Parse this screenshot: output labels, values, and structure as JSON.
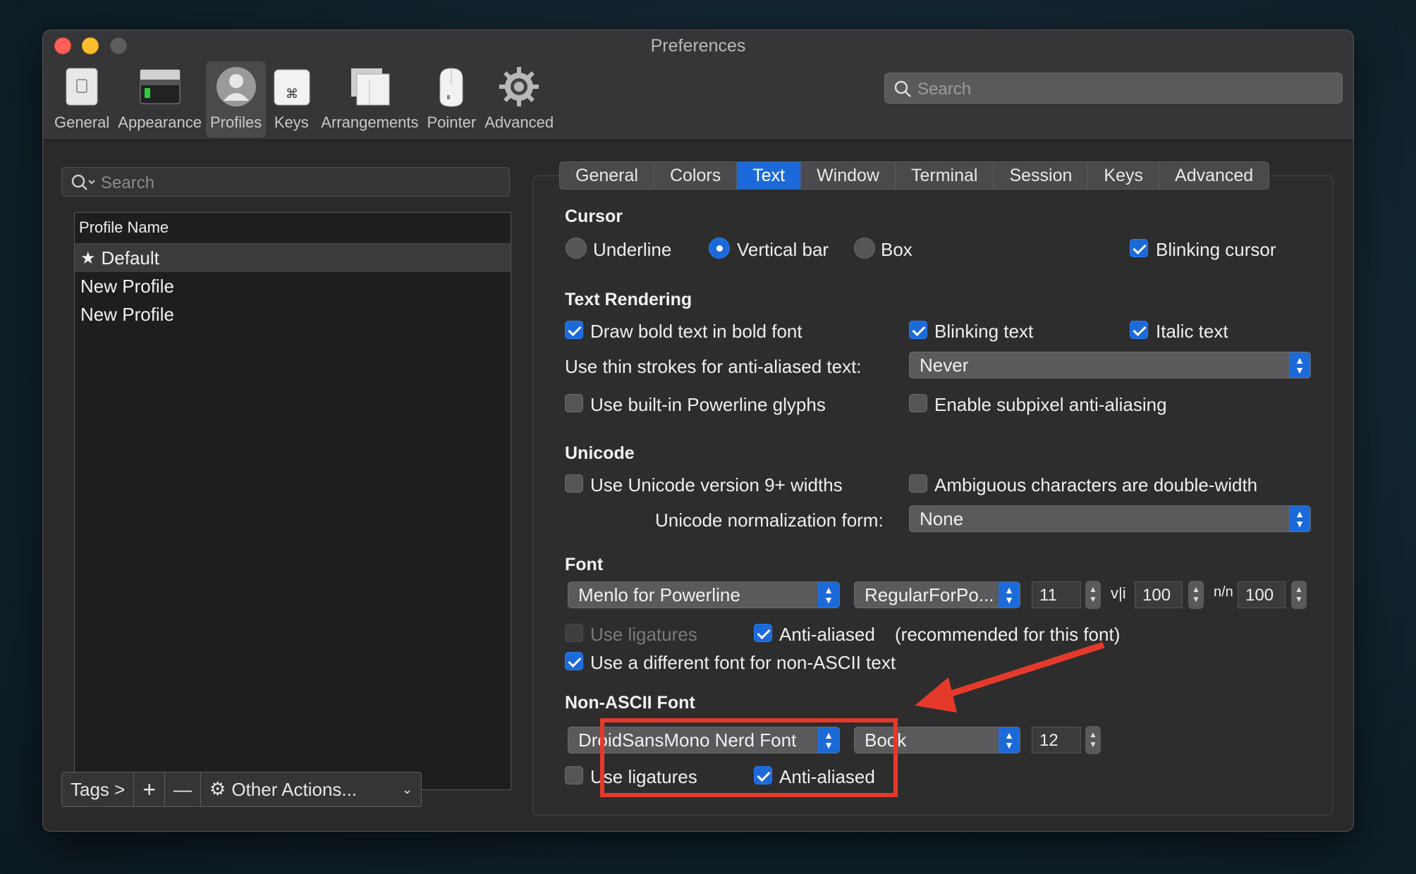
{
  "window": {
    "title": "Preferences"
  },
  "toolbar": {
    "items": [
      {
        "label": "General",
        "icon": "general-icon"
      },
      {
        "label": "Appearance",
        "icon": "appearance-icon"
      },
      {
        "label": "Profiles",
        "icon": "profiles-icon",
        "active": true
      },
      {
        "label": "Keys",
        "icon": "keys-icon"
      },
      {
        "label": "Arrangements",
        "icon": "arrangements-icon"
      },
      {
        "label": "Pointer",
        "icon": "pointer-icon"
      },
      {
        "label": "Advanced",
        "icon": "gear-icon"
      }
    ],
    "search_placeholder": "Search"
  },
  "profiles": {
    "search_placeholder": "Search",
    "header": "Profile Name",
    "items": [
      {
        "name": "Default",
        "starred": true,
        "selected": true
      },
      {
        "name": "New Profile"
      },
      {
        "name": "New Profile"
      }
    ],
    "bottom": {
      "tags": "Tags >",
      "add": "+",
      "remove": "—",
      "other": "Other Actions..."
    }
  },
  "tabs": [
    "General",
    "Colors",
    "Text",
    "Window",
    "Terminal",
    "Session",
    "Keys",
    "Advanced"
  ],
  "active_tab": "Text",
  "cursor": {
    "heading": "Cursor",
    "underline": "Underline",
    "vertical_bar": "Vertical bar",
    "box": "Box",
    "blinking": "Blinking cursor",
    "selected": "vertical_bar",
    "blinking_checked": true
  },
  "text_rendering": {
    "heading": "Text Rendering",
    "bold": "Draw bold text in bold font",
    "blinking_text": "Blinking text",
    "italic": "Italic text",
    "thin_strokes_label": "Use thin strokes for anti-aliased text:",
    "thin_strokes_value": "Never",
    "powerline": "Use built-in Powerline glyphs",
    "subpixel": "Enable subpixel anti-aliasing"
  },
  "unicode": {
    "heading": "Unicode",
    "widths": "Use Unicode version 9+ widths",
    "ambiguous": "Ambiguous characters are double-width",
    "normalization_label": "Unicode normalization form:",
    "normalization_value": "None"
  },
  "font": {
    "heading": "Font",
    "family": "Menlo for Powerline",
    "style": "RegularForPo...",
    "size": "11",
    "v_spacing_icon": "v|i",
    "v_spacing": "100",
    "h_spacing_icon": "n/n",
    "h_spacing": "100",
    "ligatures": "Use ligatures",
    "anti_aliased": "Anti-aliased",
    "recommended": "(recommended for this font)",
    "different_font": "Use a different font for non-ASCII text"
  },
  "non_ascii": {
    "heading": "Non-ASCII Font",
    "family": "DroidSansMono Nerd Font",
    "style": "Book",
    "size": "12",
    "ligatures": "Use ligatures",
    "anti_aliased": "Anti-aliased"
  },
  "colors": {
    "accent": "#1c6ad9",
    "annotation": "#e53a2b"
  }
}
